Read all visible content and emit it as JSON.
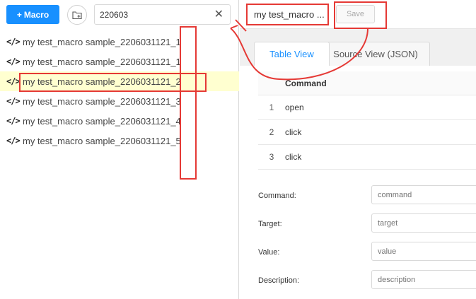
{
  "toolbar": {
    "macro_button_label": "Macro",
    "search_value": "220603",
    "clear_glyph": "✕"
  },
  "macro_list": [
    {
      "label": "my test_macro sample_2206031121_1",
      "active": false
    },
    {
      "label": "my test_macro sample_2206031121_1",
      "active": false
    },
    {
      "label": "my test_macro sample_2206031121_2",
      "active": true
    },
    {
      "label": "my test_macro sample_2206031121_3",
      "active": false
    },
    {
      "label": "my test_macro sample_2206031121_4",
      "active": false
    },
    {
      "label": "my test_macro sample_2206031121_5",
      "active": false
    }
  ],
  "editor": {
    "title": "my test_macro ...",
    "save_label": "Save",
    "tabs": [
      "Table View",
      "Source View (JSON)"
    ],
    "table_header": "Command",
    "rows": [
      {
        "num": "1",
        "command": "open"
      },
      {
        "num": "2",
        "command": "click"
      },
      {
        "num": "3",
        "command": "click"
      }
    ],
    "form": {
      "command_label": "Command",
      "command_placeholder": "command",
      "target_label": "Target",
      "target_placeholder": "target",
      "value_label": "Value",
      "value_placeholder": "value",
      "description_label": "Description",
      "description_placeholder": "description"
    }
  },
  "colors": {
    "accent": "#1890ff",
    "annotation": "#e53935",
    "active_row": "#ffffd0"
  }
}
